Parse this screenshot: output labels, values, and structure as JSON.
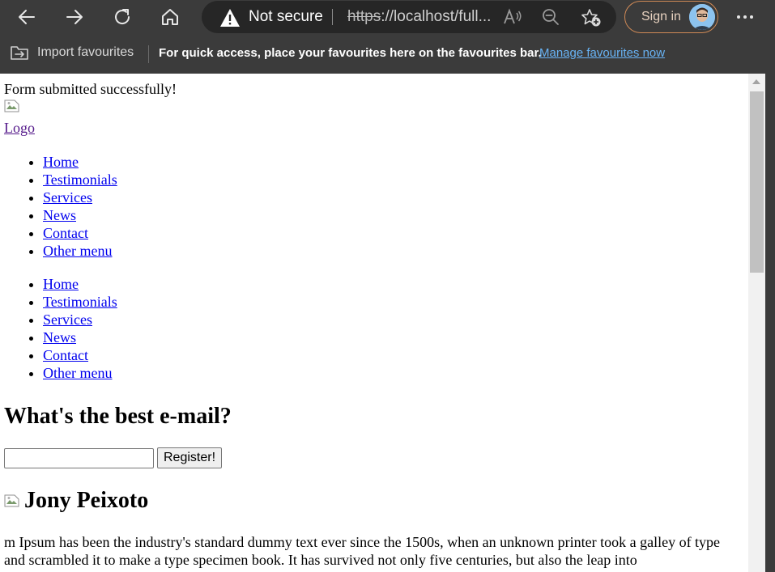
{
  "browser": {
    "security_label": "Not secure",
    "url_scheme": "https",
    "url_rest": "://localhost/full...",
    "sign_in_label": "Sign in",
    "icons": {
      "back": "arrow-left-icon",
      "forward": "arrow-right-icon",
      "refresh": "refresh-icon",
      "home": "home-icon",
      "warning": "warning-icon",
      "read_aloud": "read-aloud-icon",
      "zoom": "zoom-out-icon",
      "favourite": "add-favourite-icon",
      "more": "more-icon"
    }
  },
  "favourites_bar": {
    "import_label": "Import favourites",
    "message": "For quick access, place your favourites here on the favourites bar.",
    "manage_link": "Manage favourites now"
  },
  "page": {
    "success_message": "Form submitted successfully!",
    "logo_text": "Logo",
    "menu_1": [
      "Home",
      "Testimonials",
      "Services",
      "News",
      "Contact",
      "Other menu"
    ],
    "menu_2": [
      "Home",
      "Testimonials",
      "Services",
      "News",
      "Contact",
      "Other menu"
    ],
    "email_heading": "What's the best e-mail?",
    "email_value": "",
    "register_button": "Register!",
    "testimonial_name": "Jony Peixoto",
    "testimonial_text": "m Ipsum has been the industry's standard dummy text ever since the 1500s, when an unknown printer took a galley of type and scrambled it to make a type specimen book. It has survived not only five centuries, but also the leap into"
  },
  "colors": {
    "chrome_bg": "#3b3b3b",
    "address_bg": "#262626",
    "link_blue": "#0000ee",
    "visited_purple": "#551a8b",
    "fav_link": "#68b3f5",
    "signin_border": "#d08a56"
  }
}
